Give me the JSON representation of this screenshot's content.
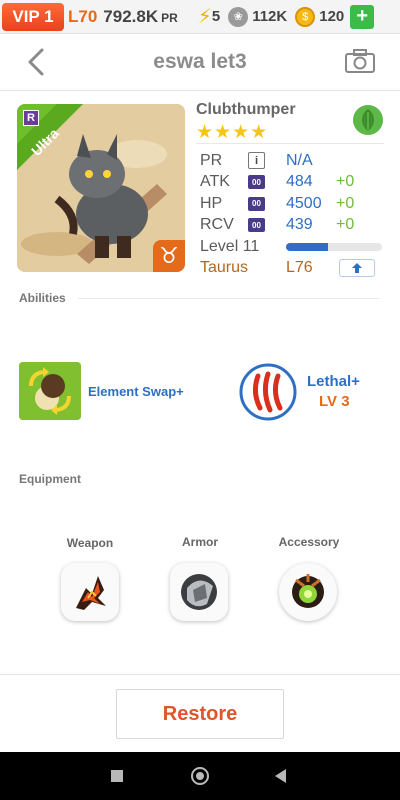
{
  "topbar": {
    "vip": "VIP 1",
    "level": "L70",
    "pr_value": "792.8K",
    "pr_label": "PR",
    "energy": "5",
    "food": "112K",
    "gold": "120",
    "add_label": "+"
  },
  "header": {
    "title": "eswa let3"
  },
  "pet": {
    "name": "Clubthumper",
    "stars": "★★★★",
    "rarity": "Ultra",
    "rarity_badge": "R",
    "stats": {
      "pr": {
        "label": "PR",
        "value": "N/A"
      },
      "atk": {
        "label": "ATK",
        "value": "484",
        "bonus": "+0"
      },
      "hp": {
        "label": "HP",
        "value": "4500",
        "bonus": "+0"
      },
      "rcv": {
        "label": "RCV",
        "value": "439",
        "bonus": "+0"
      },
      "level": {
        "label": "Level 11",
        "progress": 0.44
      },
      "sign": {
        "label": "Taurus",
        "value": "L76"
      }
    },
    "icon_badge": "00",
    "info_badge": "i",
    "zodiac_symbol": "♉"
  },
  "abilities": {
    "label": "Abilities",
    "items": [
      {
        "name": "Element Swap+"
      },
      {
        "name": "Lethal+",
        "level": "LV 3"
      }
    ]
  },
  "equipment": {
    "label": "Equipment",
    "slots": [
      {
        "label": "Weapon"
      },
      {
        "label": "Armor"
      },
      {
        "label": "Accessory"
      }
    ]
  },
  "restore_label": "Restore",
  "colors": {
    "accent_blue": "#2e6fc4",
    "accent_orange": "#e46a1c",
    "restore_red": "#e0552b",
    "bonus_green": "#6fbb3a"
  }
}
